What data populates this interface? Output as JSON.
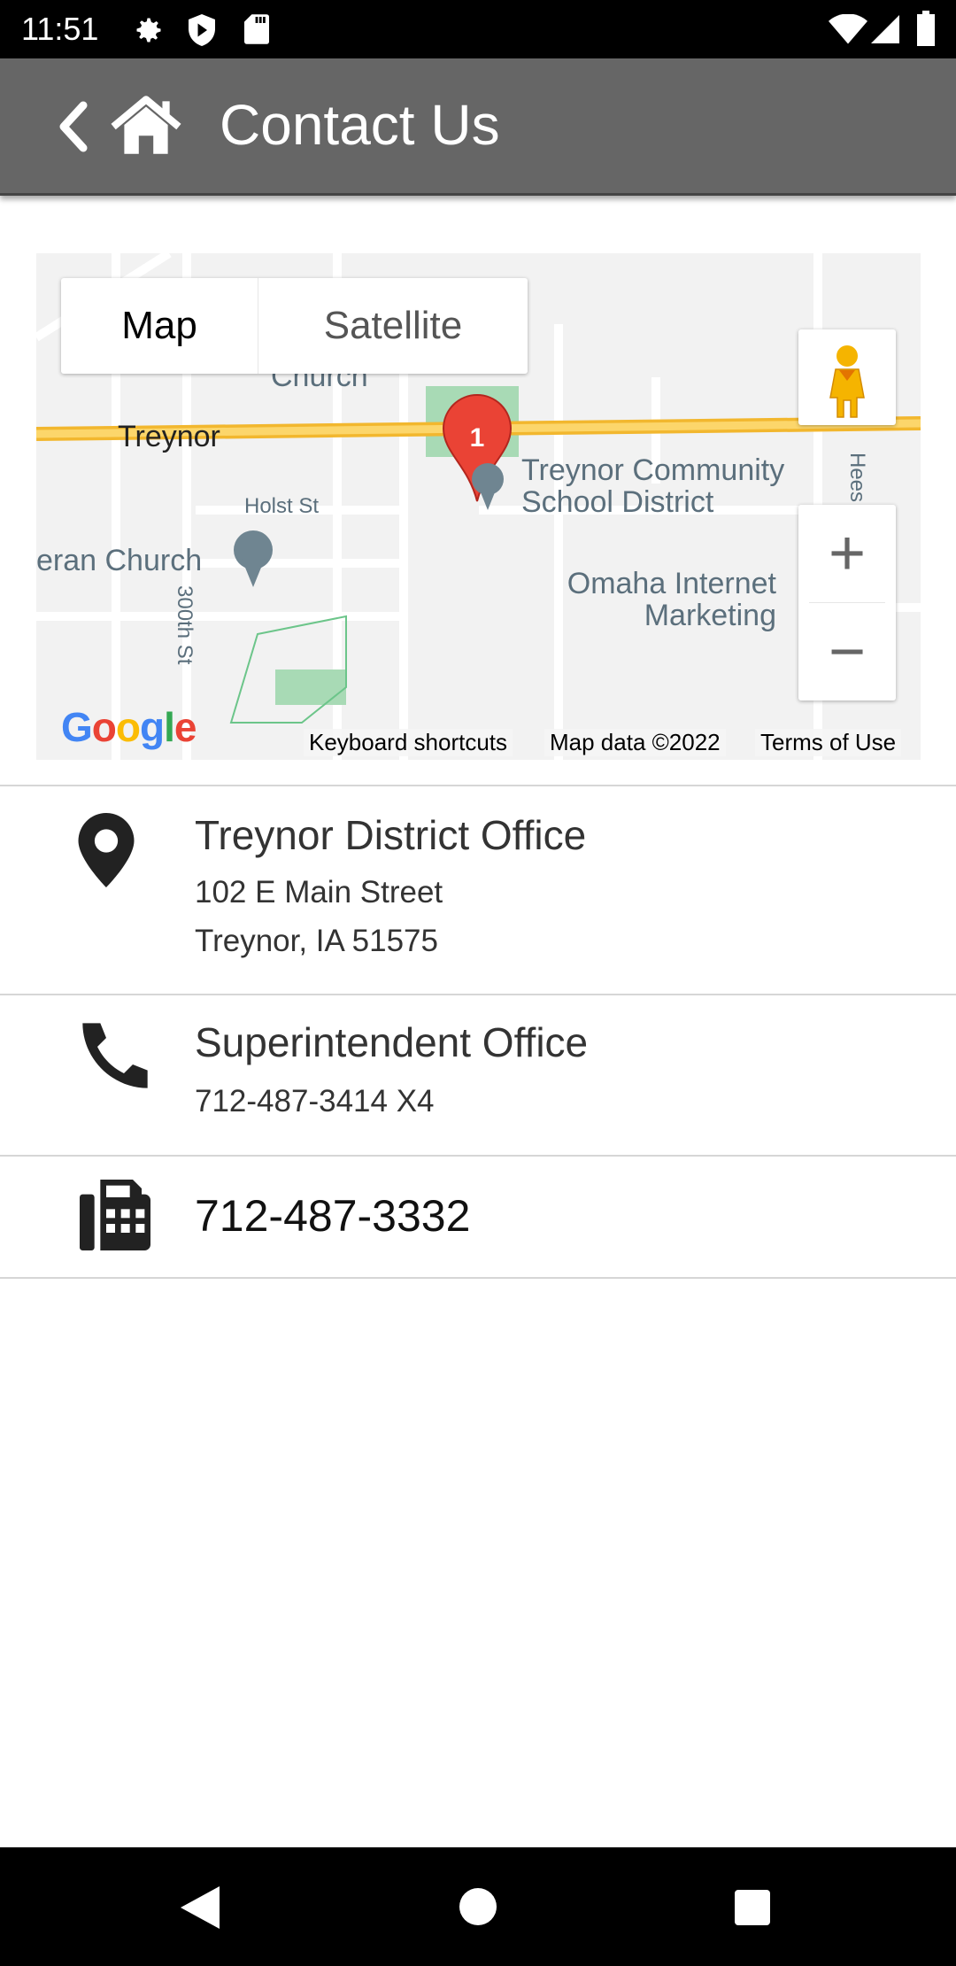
{
  "status_bar": {
    "time": "11:51",
    "icons": [
      "settings-icon",
      "shield-play-icon",
      "sd-card-icon",
      "wifi-icon",
      "signal-icon",
      "battery-icon"
    ]
  },
  "app_bar": {
    "title": "Contact Us",
    "back_icon": "chevron-left-icon",
    "home_icon": "home-icon"
  },
  "map": {
    "map_type": {
      "map": "Map",
      "satellite": "Satellite",
      "selected": "Map"
    },
    "marker_label": "1",
    "labels": {
      "church_top": "Church",
      "town": "Treynor",
      "school1": "Treynor Community",
      "school2": "School District",
      "holst": "Holst St",
      "church": "eran Church",
      "street300": "300th St",
      "omaha1": "Omaha Internet",
      "omaha2": "Marketing",
      "hees": "Hees"
    },
    "zoom_in": "+",
    "zoom_out": "−",
    "logo": "Google",
    "keyboard_shortcuts": "Keyboard shortcuts",
    "map_data": "Map data ©2022",
    "terms": "Terms of Use"
  },
  "contacts": [
    {
      "icon": "map-pin-icon",
      "title": "Treynor District Office",
      "lines": [
        "102 E Main Street",
        "Treynor, IA  51575"
      ]
    },
    {
      "icon": "phone-icon",
      "title": "Superintendent Office",
      "lines": [
        "712-487-3414 X4"
      ]
    },
    {
      "icon": "fax-icon",
      "title": "712-487-3332"
    }
  ],
  "colors": {
    "app_bar": "#666666",
    "marker": "#ea4335",
    "highway": "#f9c94a",
    "park": "#a8dab5"
  }
}
